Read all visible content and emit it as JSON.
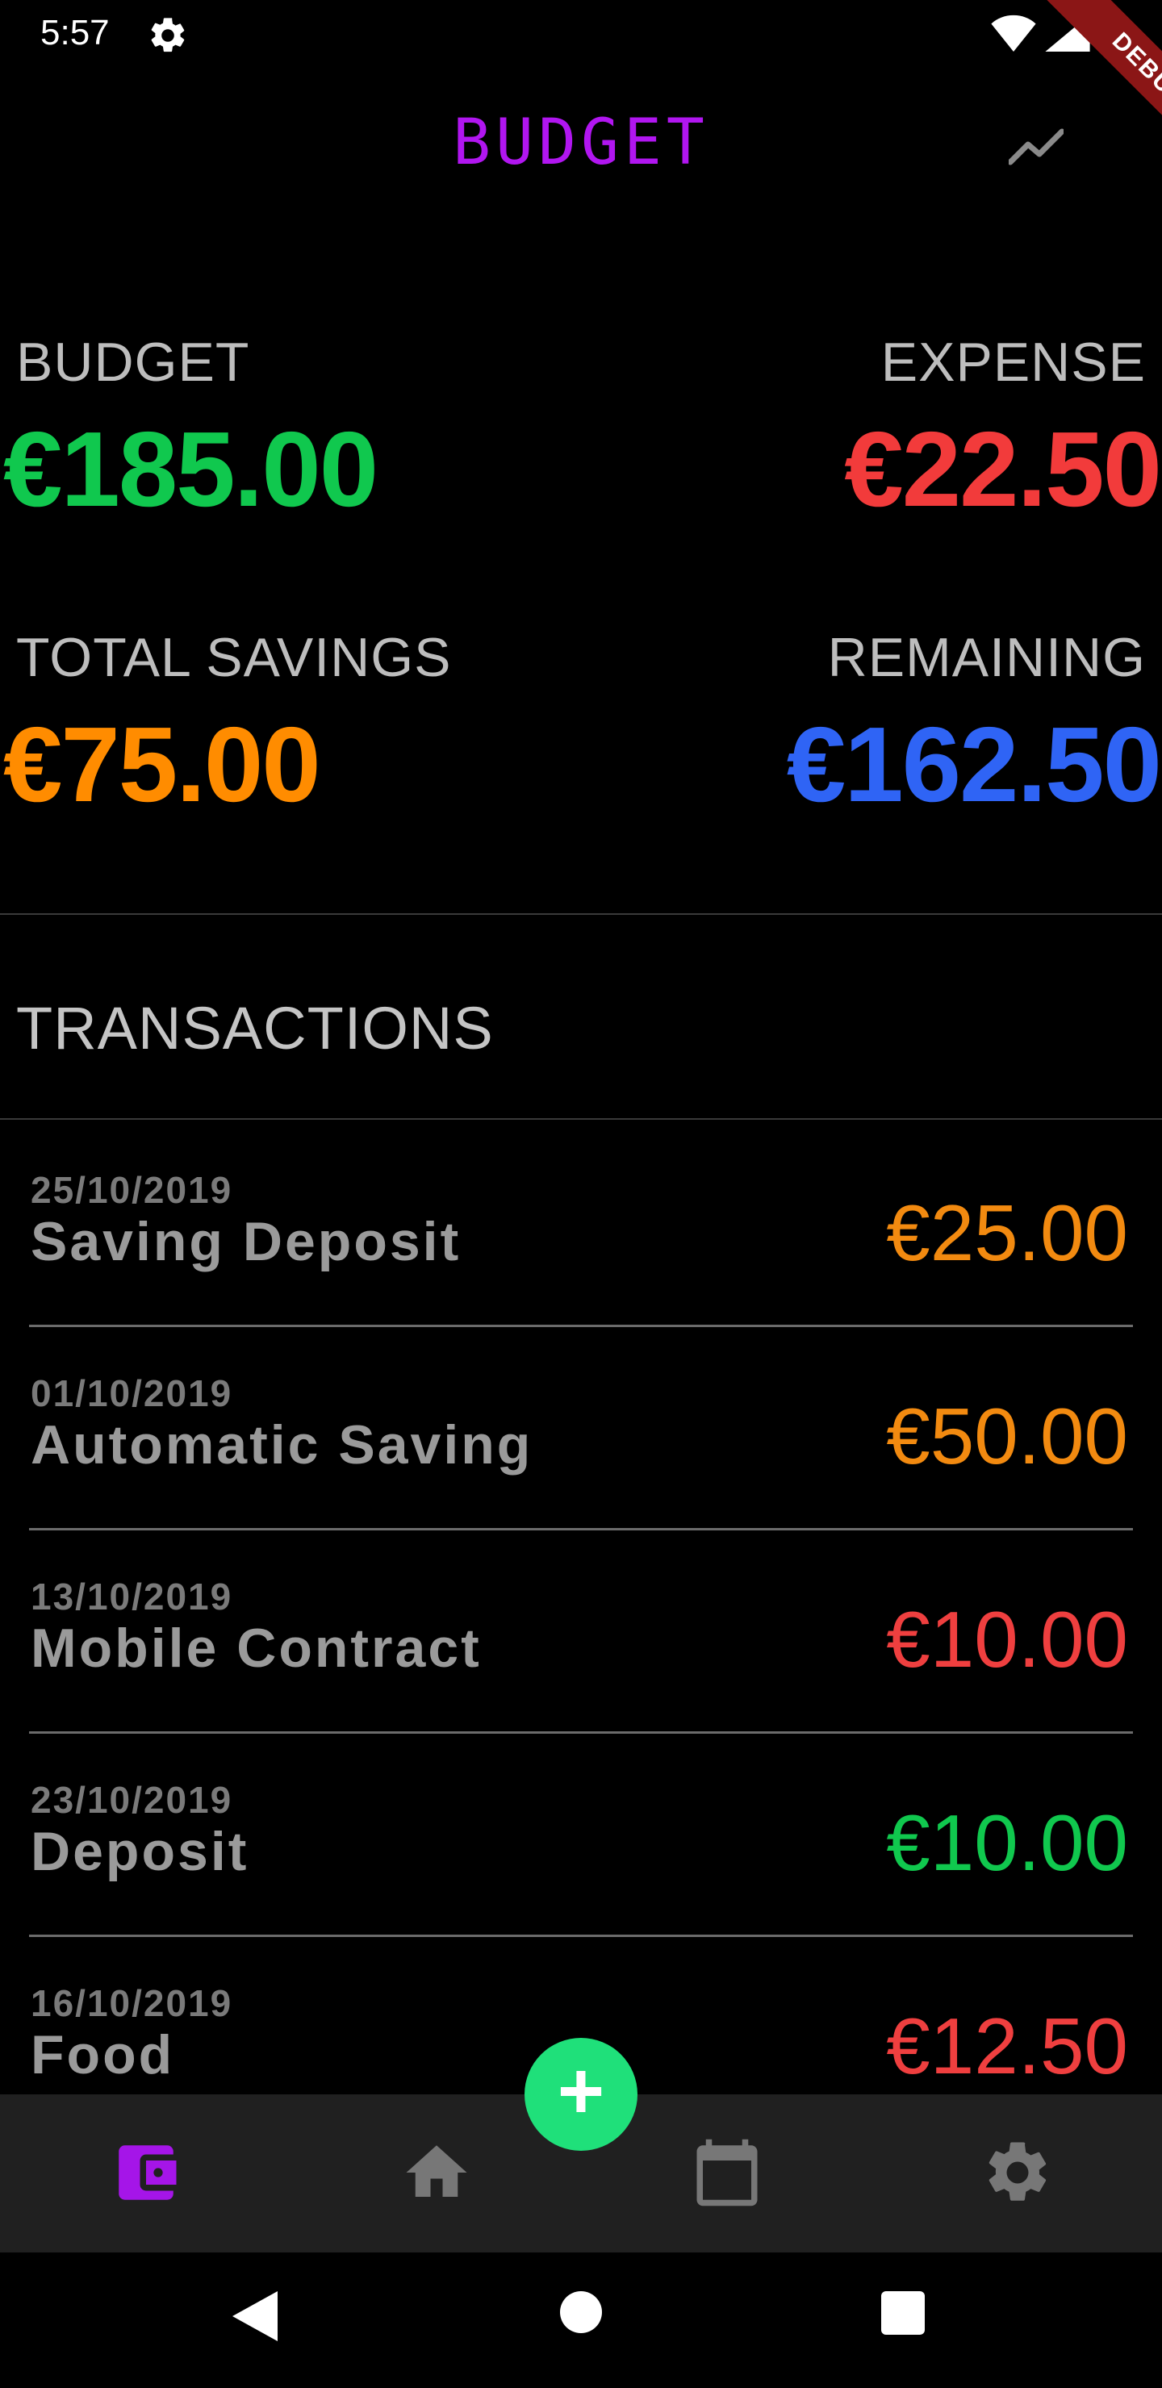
{
  "status_bar": {
    "time": "5:57"
  },
  "debug_banner": "DEBUG",
  "app_bar": {
    "title": "BUDGET"
  },
  "summary": {
    "budget": {
      "label": "BUDGET",
      "amount": "€185.00"
    },
    "expense": {
      "label": "EXPENSE",
      "amount": "€22.50"
    },
    "total_savings": {
      "label": "TOTAL SAVINGS",
      "amount": "€75.00"
    },
    "remaining": {
      "label": "REMAINING",
      "amount": "€162.50"
    }
  },
  "transactions": {
    "header": "TRANSACTIONS",
    "rows": [
      {
        "date": "25/10/2019",
        "description": "Saving Deposit",
        "amount": "€25.00"
      },
      {
        "date": "01/10/2019",
        "description": "Automatic Saving",
        "amount": "€50.00"
      },
      {
        "date": "13/10/2019",
        "description": "Mobile Contract",
        "amount": "€10.00"
      },
      {
        "date": "23/10/2019",
        "description": "Deposit",
        "amount": "€10.00"
      },
      {
        "date": "16/10/2019",
        "description": "Food",
        "amount": "€12.50"
      }
    ]
  },
  "fab": {
    "label": "+"
  },
  "bottom_nav": {
    "items": [
      {
        "icon": "wallet-icon",
        "active": true
      },
      {
        "icon": "home-icon",
        "active": false
      },
      {
        "icon": "calendar-icon",
        "active": false
      },
      {
        "icon": "gear-icon",
        "active": false
      }
    ]
  },
  "colors": {
    "title": "#b116f0",
    "budget": "#10c84e",
    "expense": "#f23b3b",
    "savings": "#ff8c00",
    "remaining": "#2f64f5",
    "saving_tx": "#f28a10",
    "expense_tx": "#ef3f3f",
    "income_tx": "#10c84e",
    "fab": "#1fe07a",
    "nav_active": "#a515e8",
    "nav_inactive": "#777777"
  }
}
